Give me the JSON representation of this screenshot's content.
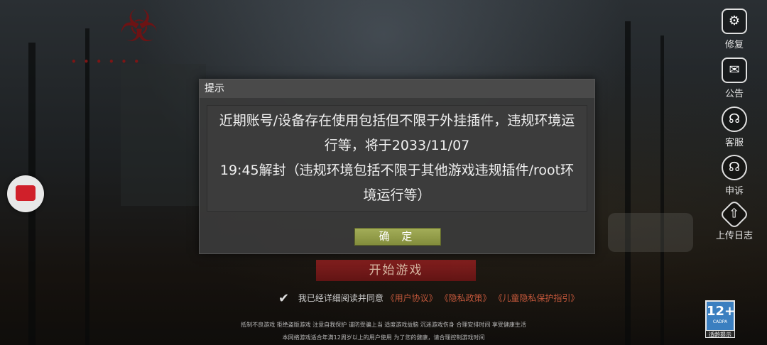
{
  "side_buttons": [
    {
      "icon": "gear-icon",
      "label": "修复"
    },
    {
      "icon": "notice-icon",
      "label": "公告"
    },
    {
      "icon": "headset-icon",
      "label": "客服"
    },
    {
      "icon": "headset-icon",
      "label": "申诉"
    },
    {
      "icon": "upload-icon",
      "label": "上传日志"
    }
  ],
  "dialog": {
    "title": "提示",
    "message_lines": [
      "近期账号/设备存在使用包括但不限于外挂插件，违规环境运",
      "行等，将于2033/11/07",
      "19:45解封（违规环境包括不限于其他游戏违规插件/root环",
      "境运行等）"
    ],
    "ok_label": "确 定"
  },
  "start_button": "开始游戏",
  "agreement": {
    "text": "我已经详细阅读并同意",
    "links": [
      "《用户协议》",
      "《隐私政策》",
      "《儿童隐私保护指引》"
    ]
  },
  "footer": {
    "line1": "抵制不良游戏  拒绝盗版游戏  注意自我保护  谨防受骗上当  适度游戏益脑  沉迷游戏伤身  合理安排时间  享受健康生活",
    "line2": "本网络游戏适合年满12周岁以上的用户使用    为了您的健康，请合理控制游戏时间"
  },
  "age_rating": {
    "number": "12+",
    "org": "CADPA",
    "tip": "适龄提示"
  },
  "colors": {
    "ok_button": "#949e48",
    "start_button": "#7d1a1a",
    "link": "#c0563a",
    "dialog_bg": "#3a3a3a"
  }
}
